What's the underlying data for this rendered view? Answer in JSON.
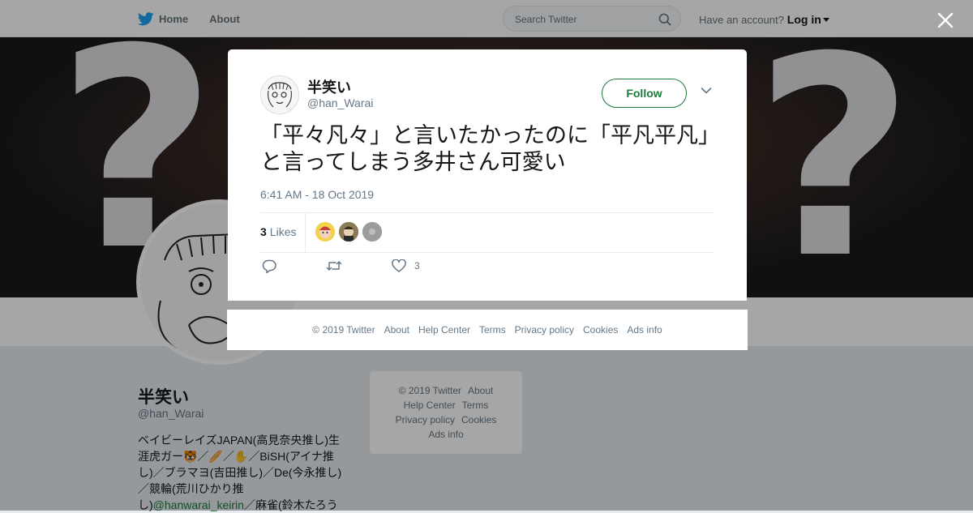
{
  "nav": {
    "home_label": "Home",
    "about_label": "About",
    "search_placeholder": "Search Twitter",
    "account_prompt": "Have an account?",
    "login_label": "Log in",
    "brand_color": "#1da1f2"
  },
  "profile": {
    "name": "半笑い",
    "handle": "@han_Warai",
    "bio_text": "ベイビーレイズJAPAN(高見奈央推し)生涯虎ガー🐯／🥖／✋／BiSH(アイナ推し)／ブラマヨ(吉田推し)／De(今永推し)／競輪(荒川ひかり推し)",
    "bio_mention": "@hanwarai_keirin",
    "bio_tail": "／麻雀(鈴木たろう"
  },
  "side_footer": {
    "copyright": "© 2019 Twitter",
    "about": "About",
    "help": "Help Center",
    "terms": "Terms",
    "privacy": "Privacy policy",
    "cookies": "Cookies",
    "ads": "Ads info"
  },
  "tweet": {
    "author_name": "半笑い",
    "author_handle": "@han_Warai",
    "follow_label": "Follow",
    "text": "「平々凡々」と言いたかったのに「平凡平凡」と言ってしまう多井さん可愛い",
    "timestamp": "6:41 AM - 18 Oct 2019",
    "likes_count": "3",
    "likes_label": "Likes",
    "like_action_count": "3",
    "accent_color": "#1b7a3a"
  },
  "footer": {
    "copyright": "© 2019 Twitter",
    "about": "About",
    "help": "Help Center",
    "terms": "Terms",
    "privacy": "Privacy policy",
    "cookies": "Cookies",
    "ads": "Ads info"
  },
  "icons": {
    "close": "close-icon",
    "search": "search-icon",
    "reply": "reply-icon",
    "retweet": "retweet-icon",
    "like": "heart-icon"
  }
}
